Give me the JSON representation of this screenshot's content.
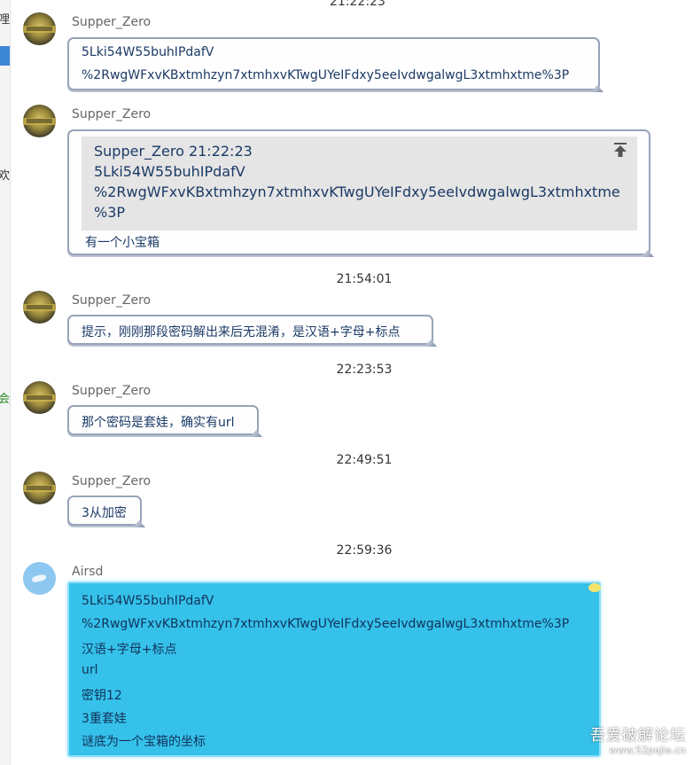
{
  "left_fragments": [
    "哩",
    "欢",
    "会"
  ],
  "top_time": "21:22:23",
  "messages": [
    {
      "sender": "Supper_Zero",
      "lines": [
        "5Lki54W55buhIPdafV",
        "%2RwgWFxvKBxtmhzyn7xtmhxvKTwgUYeIFdxy5eeIvdwgalwgL3xtmhxtme%3P"
      ]
    },
    {
      "sender": "Supper_Zero",
      "quote": {
        "header": "Supper_Zero    21:22:23",
        "lines": [
          "5Lki54W55buhIPdafV",
          "%2RwgWFxvKBxtmhzyn7xtmhxvKTwgUYeIFdxy5eeIvdwgalwgL3xtmhxtme",
          "%3P"
        ]
      },
      "reply": "有一个小宝箱"
    },
    {
      "time": "21:54:01",
      "sender": "Supper_Zero",
      "text": "提示，刚刚那段密码解出来后无混淆，是汉语+字母+标点"
    },
    {
      "time": "22:23:53",
      "sender": "Supper_Zero",
      "text": "那个密码是套娃，确实有url"
    },
    {
      "time": "22:49:51",
      "sender": "Supper_Zero",
      "text": "3从加密"
    },
    {
      "time": "22:59:36",
      "sender": "Airsd",
      "lines": [
        "5Lki54W55buhIPdafV",
        "%2RwgWFxvKBxtmhzyn7xtmhxvKTwgUYeIFdxy5eeIvdwgalwgL3xtmhxtme%3P",
        "汉语+字母+标点",
        "url",
        "密钥12",
        "3重套娃",
        "谜底为一个宝箱的坐标"
      ]
    }
  ],
  "watermark": {
    "line1": "吾爱破解论坛",
    "line2": "www.52pojie.cn"
  },
  "colors": {
    "bubble_blue": "#35c1ea",
    "text_blue": "#1b3a66",
    "bubble_border": "#98a3b8"
  },
  "icons": [
    "pin-to-top-icon",
    "avatar-supper-zero",
    "avatar-airsd"
  ]
}
